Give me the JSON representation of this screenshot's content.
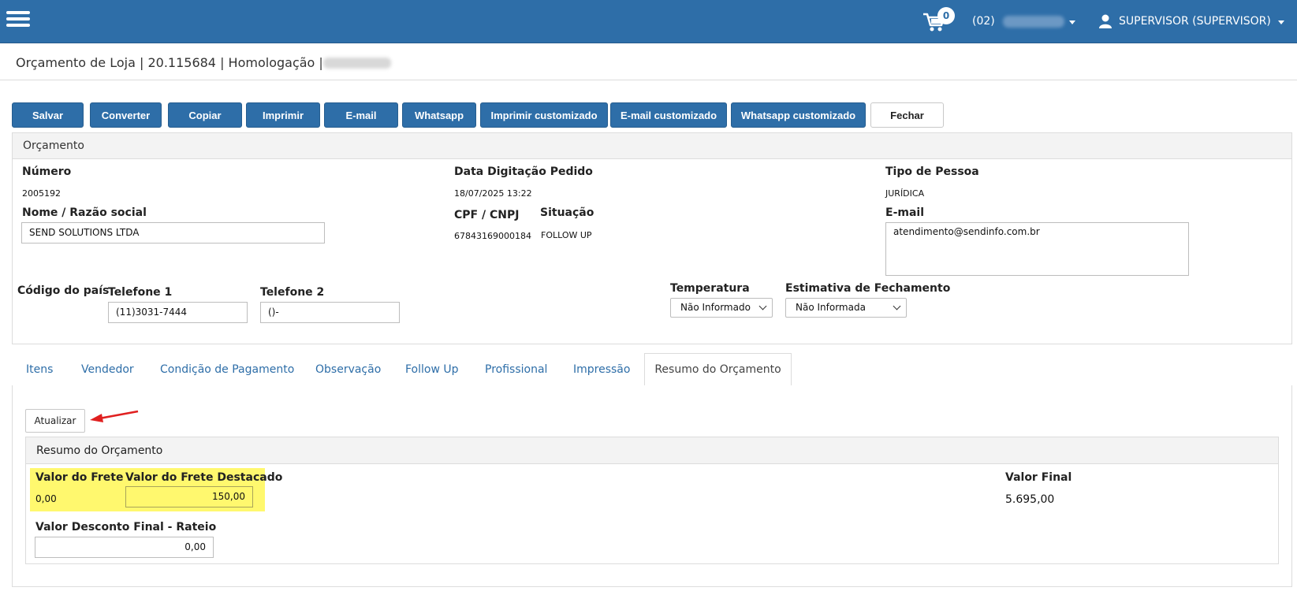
{
  "header": {
    "cart_count": "0",
    "store_code": "(02)",
    "user_label": "SUPERVISOR (SUPERVISOR)"
  },
  "breadcrumb": "Orçamento de Loja | 20.115684 | Homologação |",
  "toolbar": {
    "salvar": "Salvar",
    "converter": "Converter",
    "copiar": "Copiar",
    "imprimir": "Imprimir",
    "email": "E-mail",
    "whatsapp": "Whatsapp",
    "imprimir_customizado": "Imprimir customizado",
    "email_customizado": "E-mail customizado",
    "whatsapp_customizado": "Whatsapp customizado",
    "fechar": "Fechar"
  },
  "orcamento": {
    "title": "Orçamento",
    "numero_label": "Número",
    "numero": "2005192",
    "data_label": "Data Digitação Pedido",
    "data": "18/07/2025 13:22",
    "tipo_label": "Tipo de Pessoa",
    "tipo": "JURÍDICA",
    "nome_label": "Nome / Razão social",
    "nome": "SEND SOLUTIONS LTDA",
    "cpf_label": "CPF / CNPJ",
    "cpf": "67843169000184",
    "situacao_label": "Situação",
    "situacao": "FOLLOW UP",
    "email_label": "E-mail",
    "email": "atendimento@sendinfo.com.br",
    "codigo_pais_label": "Código do país",
    "telefone1_label": "Telefone 1",
    "telefone1": "(11)3031-7444",
    "telefone2_label": "Telefone 2",
    "telefone2": "()-",
    "temperatura_label": "Temperatura",
    "temperatura": "Não Informado",
    "estimativa_label": "Estimativa de Fechamento",
    "estimativa": "Não Informada"
  },
  "tabs": {
    "itens": "Itens",
    "vendedor": "Vendedor",
    "condicao": "Condição de Pagamento",
    "observacao": "Observação",
    "follow_up": "Follow Up",
    "profissional": "Profissional",
    "impressao": "Impressão",
    "resumo": "Resumo do Orçamento"
  },
  "resumo": {
    "atualizar": "Atualizar",
    "title": "Resumo do Orçamento",
    "frete_label": "Valor do Frete",
    "frete": "0,00",
    "frete_destacado_label": "Valor do Frete Destacado",
    "frete_destacado": "150,00",
    "valor_final_label": "Valor Final",
    "valor_final": "5.695,00",
    "desconto_label": "Valor Desconto Final - Rateio",
    "desconto": "0,00"
  },
  "colors": {
    "primary": "#2e6ea8",
    "highlight": "#fff86e",
    "arrow": "#e02020"
  }
}
